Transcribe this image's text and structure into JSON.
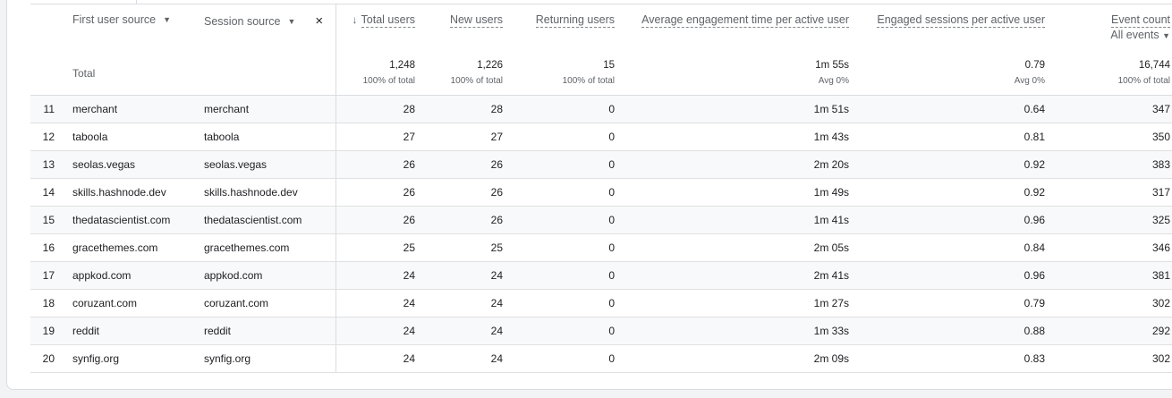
{
  "header": {
    "dim1": "First user source",
    "dim2": "Session source",
    "close_glyph": "×",
    "sort_glyph": "↓",
    "caret_glyph": "▼",
    "metrics": [
      {
        "label": "Total users"
      },
      {
        "label": "New users"
      },
      {
        "label": "Returning users"
      },
      {
        "label": "Average engagement time per active user"
      },
      {
        "label": "Engaged sessions per active user"
      },
      {
        "label": "Event count",
        "sub": "All events"
      }
    ]
  },
  "totals": {
    "label": "Total",
    "values": [
      {
        "main": "1,248",
        "sub": "100% of total"
      },
      {
        "main": "1,226",
        "sub": "100% of total"
      },
      {
        "main": "15",
        "sub": "100% of total"
      },
      {
        "main": "1m 55s",
        "sub": "Avg 0%"
      },
      {
        "main": "0.79",
        "sub": "Avg 0%"
      },
      {
        "main": "16,744",
        "sub": "100% of total"
      }
    ]
  },
  "rows": [
    {
      "idx": "11",
      "first": "merchant",
      "session": "merchant",
      "total": "28",
      "new": "28",
      "ret": "0",
      "avg": "1m 51s",
      "eng": "0.64",
      "events": "347"
    },
    {
      "idx": "12",
      "first": "taboola",
      "session": "taboola",
      "total": "27",
      "new": "27",
      "ret": "0",
      "avg": "1m 43s",
      "eng": "0.81",
      "events": "350"
    },
    {
      "idx": "13",
      "first": "seolas.vegas",
      "session": "seolas.vegas",
      "total": "26",
      "new": "26",
      "ret": "0",
      "avg": "2m 20s",
      "eng": "0.92",
      "events": "383"
    },
    {
      "idx": "14",
      "first": "skills.hashnode.dev",
      "session": "skills.hashnode.dev",
      "total": "26",
      "new": "26",
      "ret": "0",
      "avg": "1m 49s",
      "eng": "0.92",
      "events": "317"
    },
    {
      "idx": "15",
      "first": "thedatascientist.com",
      "session": "thedatascientist.com",
      "total": "26",
      "new": "26",
      "ret": "0",
      "avg": "1m 41s",
      "eng": "0.96",
      "events": "325"
    },
    {
      "idx": "16",
      "first": "gracethemes.com",
      "session": "gracethemes.com",
      "total": "25",
      "new": "25",
      "ret": "0",
      "avg": "2m 05s",
      "eng": "0.84",
      "events": "346"
    },
    {
      "idx": "17",
      "first": "appkod.com",
      "session": "appkod.com",
      "total": "24",
      "new": "24",
      "ret": "0",
      "avg": "2m 41s",
      "eng": "0.96",
      "events": "381"
    },
    {
      "idx": "18",
      "first": "coruzant.com",
      "session": "coruzant.com",
      "total": "24",
      "new": "24",
      "ret": "0",
      "avg": "1m 27s",
      "eng": "0.79",
      "events": "302"
    },
    {
      "idx": "19",
      "first": "reddit",
      "session": "reddit",
      "total": "24",
      "new": "24",
      "ret": "0",
      "avg": "1m 33s",
      "eng": "0.88",
      "events": "292"
    },
    {
      "idx": "20",
      "first": "synfig.org",
      "session": "synfig.org",
      "total": "24",
      "new": "24",
      "ret": "0",
      "avg": "2m 09s",
      "eng": "0.83",
      "events": "302"
    }
  ]
}
